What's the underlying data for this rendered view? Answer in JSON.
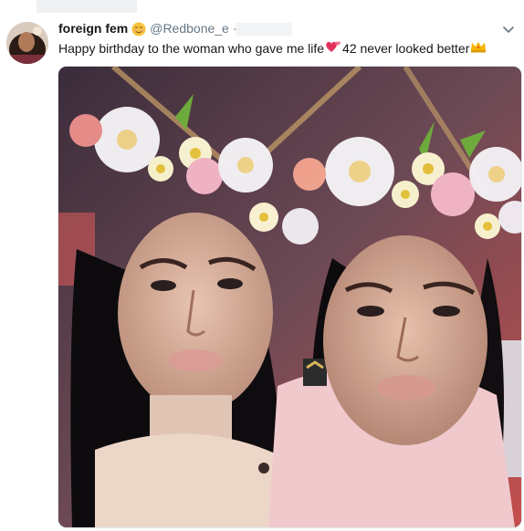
{
  "tweet": {
    "display_name": "foreign fem",
    "name_emoji": "relieved-face-emoji",
    "handle": "@Redbone_e",
    "separator": "·",
    "text_part1": "Happy birthday to the woman who gave me life",
    "text_emoji1": "two-hearts-emoji",
    "text_part2": "42 never looked better",
    "text_emoji2": "crown-emoji"
  },
  "colors": {
    "name": "#14171a",
    "handle": "#657786",
    "media_border": "#e1e8ed"
  },
  "icons": {
    "more": "chevron-down-icon"
  }
}
